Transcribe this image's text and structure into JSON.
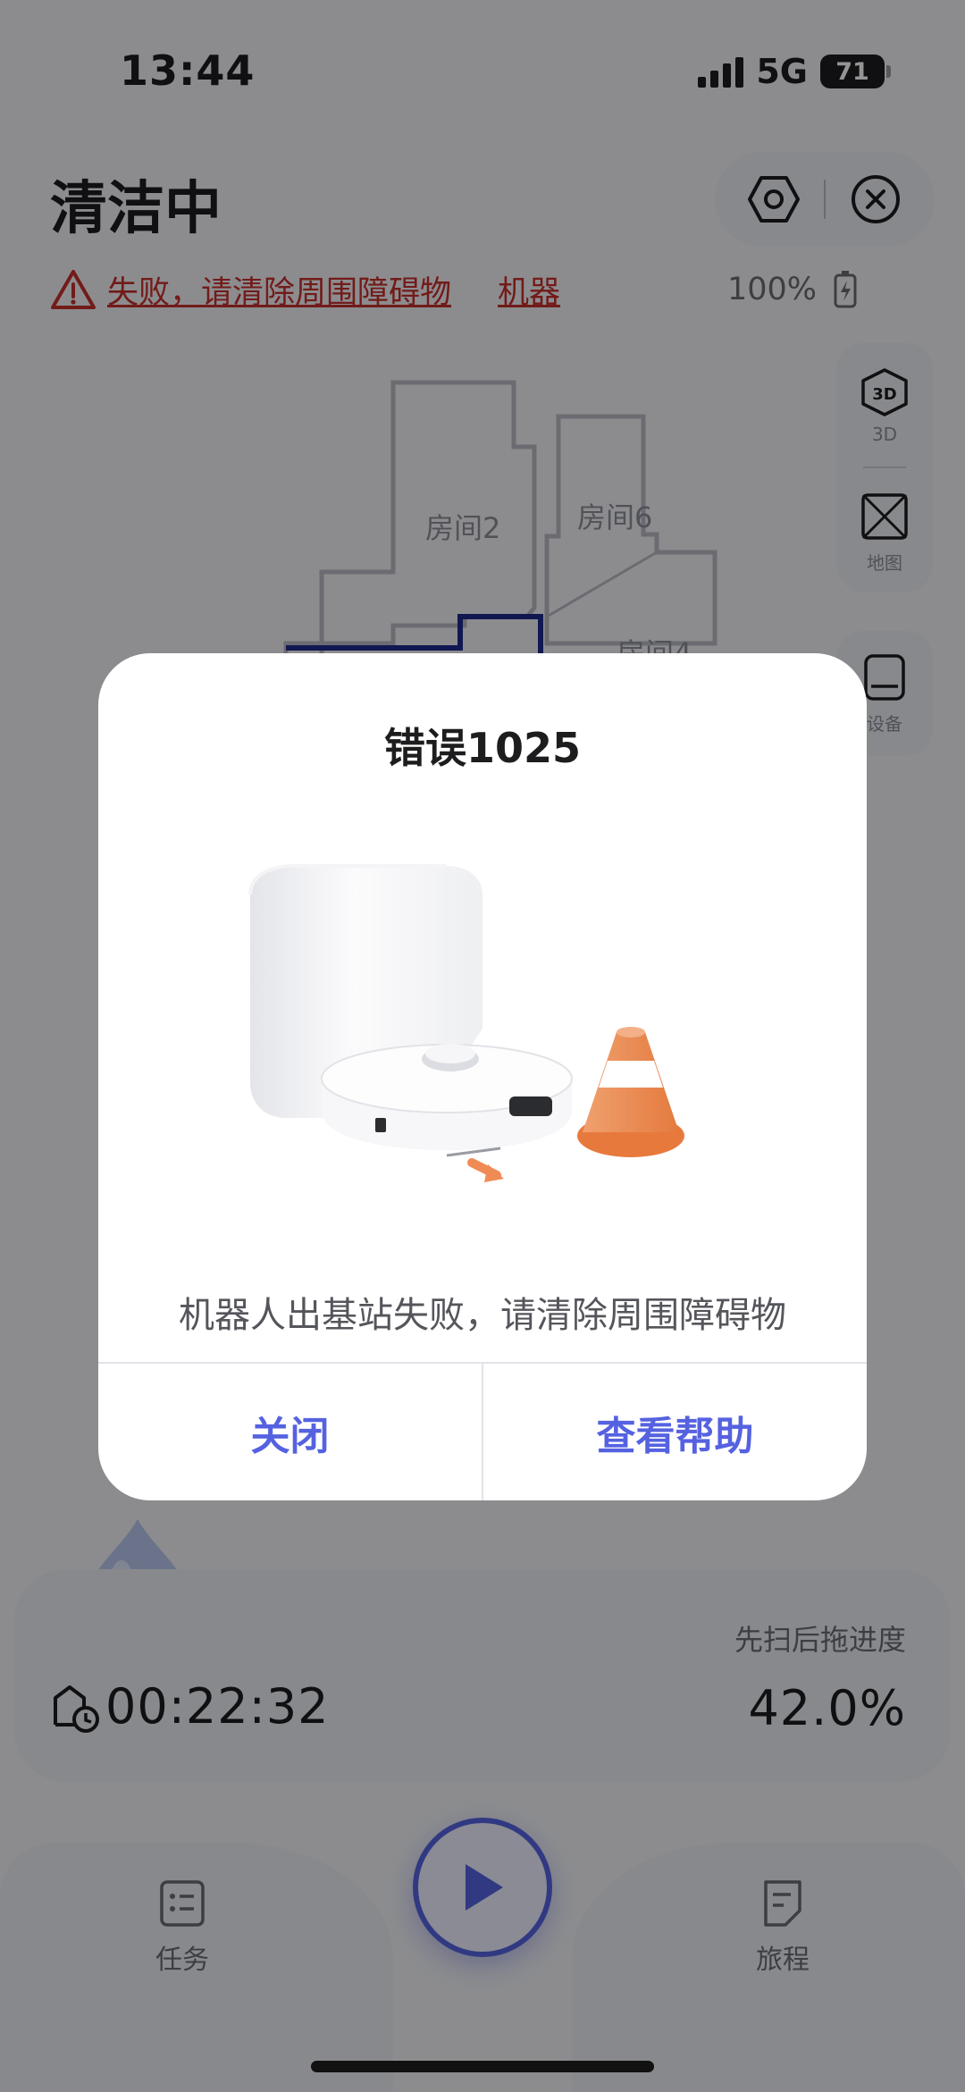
{
  "status_bar": {
    "time": "13:44",
    "network": "5G",
    "battery": "71"
  },
  "header": {
    "title": "清洁中"
  },
  "alert": {
    "message": "失败，请清除周围障碍物",
    "message2": "机器",
    "battery_percent": "100%"
  },
  "map": {
    "rooms": [
      {
        "label": "房间2"
      },
      {
        "label": "房间6"
      },
      {
        "label": "房间4"
      }
    ]
  },
  "side_panel": {
    "view_3d_label": "3D",
    "map_label": "地图",
    "device_label": "设备"
  },
  "progress": {
    "label": "先扫后拖进度",
    "timer": "00:22:32",
    "percent": "42.0%"
  },
  "bottom_nav": {
    "tasks_label": "任务",
    "journey_label": "旅程"
  },
  "dialog": {
    "title": "错误1025",
    "message": "机器人出基站失败，请清除周围障碍物",
    "close_label": "关闭",
    "help_label": "查看帮助"
  },
  "colors": {
    "accent": "#5562e0",
    "error": "#c4302b",
    "cone": "#ee8a52"
  }
}
